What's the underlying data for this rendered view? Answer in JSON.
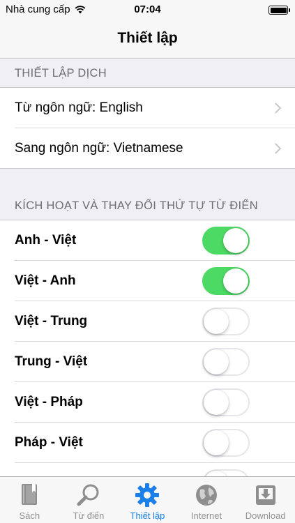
{
  "status_bar": {
    "carrier": "Nhà cung cấp",
    "time": "07:04"
  },
  "nav": {
    "title": "Thiết lập"
  },
  "translation_section": {
    "header": "THIẾT LẬP DỊCH",
    "rows": [
      {
        "label": "Từ ngôn ngữ: English"
      },
      {
        "label": "Sang ngôn ngữ: Vietnamese"
      }
    ]
  },
  "dictionary_section": {
    "header": "KÍCH HOẠT VÀ THAY ĐỔI THỨ TỰ TỪ ĐIỂN",
    "items": [
      {
        "label": "Anh - Việt",
        "enabled": true
      },
      {
        "label": "Việt - Anh",
        "enabled": true
      },
      {
        "label": "Việt - Trung",
        "enabled": false
      },
      {
        "label": "Trung - Việt",
        "enabled": false
      },
      {
        "label": "Việt - Pháp",
        "enabled": false
      },
      {
        "label": "Pháp - Việt",
        "enabled": false
      }
    ]
  },
  "tabs": [
    {
      "label": "Sách",
      "icon": "book-icon",
      "active": false
    },
    {
      "label": "Từ điển",
      "icon": "magnifier-icon",
      "active": false
    },
    {
      "label": "Thiết lập",
      "icon": "gear-icon",
      "active": true
    },
    {
      "label": "Internet",
      "icon": "globe-icon",
      "active": false
    },
    {
      "label": "Download",
      "icon": "download-icon",
      "active": false
    }
  ],
  "colors": {
    "switch_on": "#4cd964",
    "tab_active": "#1a7fe8",
    "tab_inactive": "#929292"
  }
}
